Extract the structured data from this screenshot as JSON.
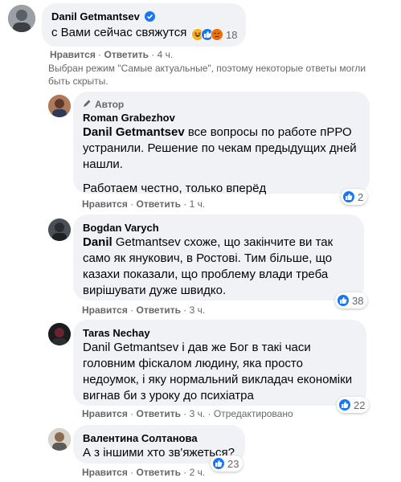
{
  "colors": {
    "bubble": "#f0f2f5",
    "muted": "#65676b",
    "like_blue": "#1877f2"
  },
  "main_comment": {
    "author": "Danil Getmantsev",
    "verified": true,
    "text": "с Вами сейчас свяжутся",
    "reactions": {
      "icons": [
        "haha-icon",
        "like-icon",
        "angry-icon"
      ],
      "count": "18"
    },
    "like_label": "Нравится",
    "reply_label": "Ответить",
    "time": "4 ч."
  },
  "notice": "Выбран режим \"Самые актуальные\", поэтому некоторые ответы могли быть скрыты.",
  "replies": [
    {
      "badge": "Автор",
      "author": "Roman Grabezhov",
      "mention": "Danil Getmantsev",
      "text": " все вопросы по работе пРРО устранили. Решение по чекам предыдущих дней нашли.",
      "text2": "Работаем честно, только вперёд",
      "reaction_count": "2",
      "like_label": "Нравится",
      "reply_label": "Ответить",
      "time": "1 ч."
    },
    {
      "author": "Bogdan Varych",
      "mention": "Danil",
      "text": " Getmantsev схоже, що закінчите ви так само як янукович, в Ростові. Тим більше, що казахи показали, що проблему влади треба вирішувати дуже швидко.",
      "reaction_count": "38",
      "like_label": "Нравится",
      "reply_label": "Ответить",
      "time": "3 ч."
    },
    {
      "author": "Taras Nechay",
      "text": "Danil Getmantsev і дав же Бог в такі часи головним фіскалом людину, яка просто недоумок, і яку нормальний викладач економіки вигнав би з уроку до психіатра",
      "reaction_count": "22",
      "like_label": "Нравится",
      "reply_label": "Ответить",
      "time": "3 ч.",
      "edited": "Отредактировано"
    },
    {
      "author": "Валентина Солтанова",
      "text": "А з іншими хто зв'яжеться?",
      "reaction_count": "23",
      "like_label": "Нравится",
      "reply_label": "Ответить",
      "time": "2 ч."
    }
  ]
}
